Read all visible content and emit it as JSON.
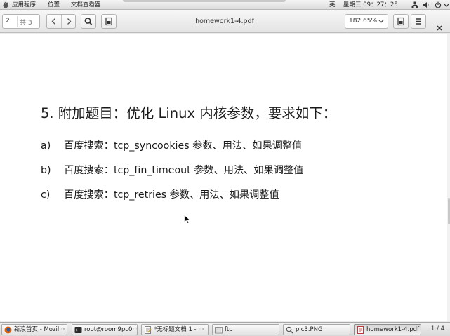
{
  "top_panel": {
    "menus": [
      "应用程序",
      "位置",
      "文档查看器"
    ],
    "input_method": "英",
    "clock": "星期三 09：27：25"
  },
  "toolbar": {
    "page_number": "2",
    "page_total": "共 3",
    "document_title": "homework1-4.pdf",
    "zoom_value": "182.65%"
  },
  "document": {
    "heading": "5. 附加题目：优化 Linux 内核参数，要求如下：",
    "items": [
      {
        "letter": "a)",
        "text": "百度搜索：tcp_syncookies 参数、用法、如果调整值"
      },
      {
        "letter": "b)",
        "text": "百度搜索：tcp_fin_timeout 参数、用法、如果调整值"
      },
      {
        "letter": "c)",
        "text": "百度搜索：tcp_retries 参数、用法、如果调整值"
      }
    ]
  },
  "taskbar": {
    "tasks": [
      {
        "label": "新浪首页 - Mozil···",
        "icon": "firefox-icon"
      },
      {
        "label": "root@room9pc0···",
        "icon": "terminal-icon"
      },
      {
        "label": "*无标题文档 1 - ···",
        "icon": "text-editor-icon"
      },
      {
        "label": "ftp",
        "icon": "folder-icon"
      },
      {
        "label": "pic3.PNG",
        "icon": "image-viewer-icon"
      },
      {
        "label": "homework1-4.pdf",
        "icon": "pdf-icon"
      }
    ],
    "workspace": "1 / 4"
  }
}
